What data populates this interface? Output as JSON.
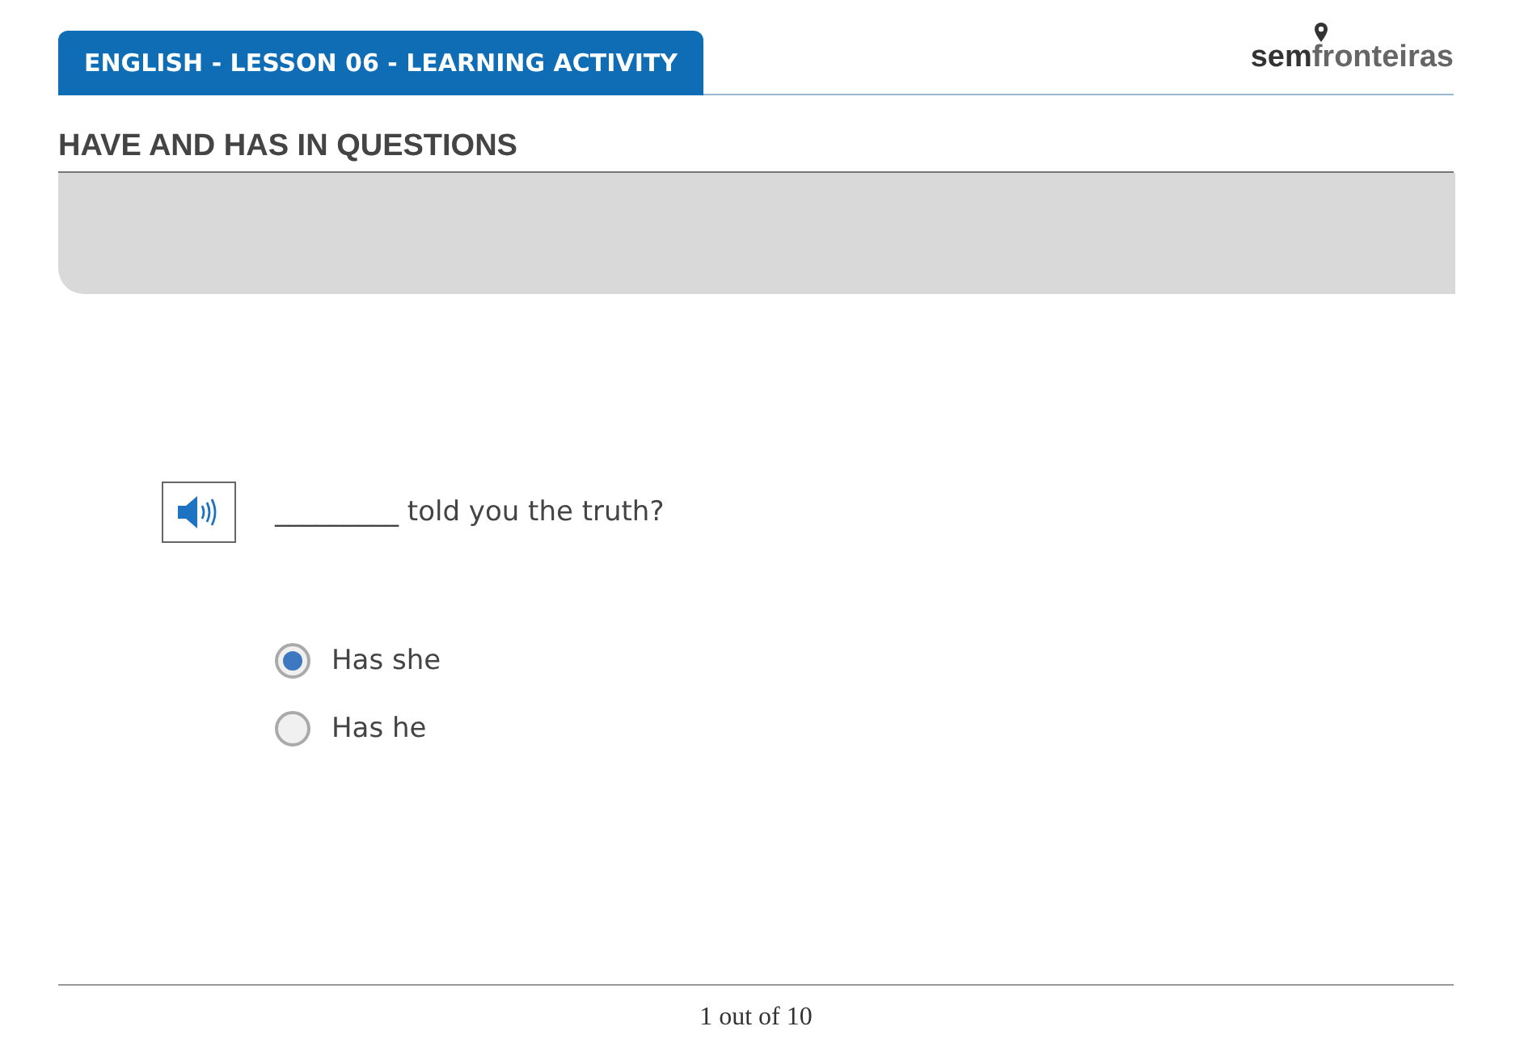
{
  "header": {
    "title": "ENGLISH - LESSON 06 - LEARNING ACTIVITY",
    "logo": {
      "part_1": "sem",
      "part_2": "fronteiras"
    }
  },
  "section_title": "HAVE AND HAS IN QUESTIONS",
  "question": {
    "blank": "_________",
    "text": " told you the truth?"
  },
  "options": [
    {
      "label": "Has she",
      "selected": true
    },
    {
      "label": "Has he",
      "selected": false
    }
  ],
  "pager": "1 out of 10"
}
